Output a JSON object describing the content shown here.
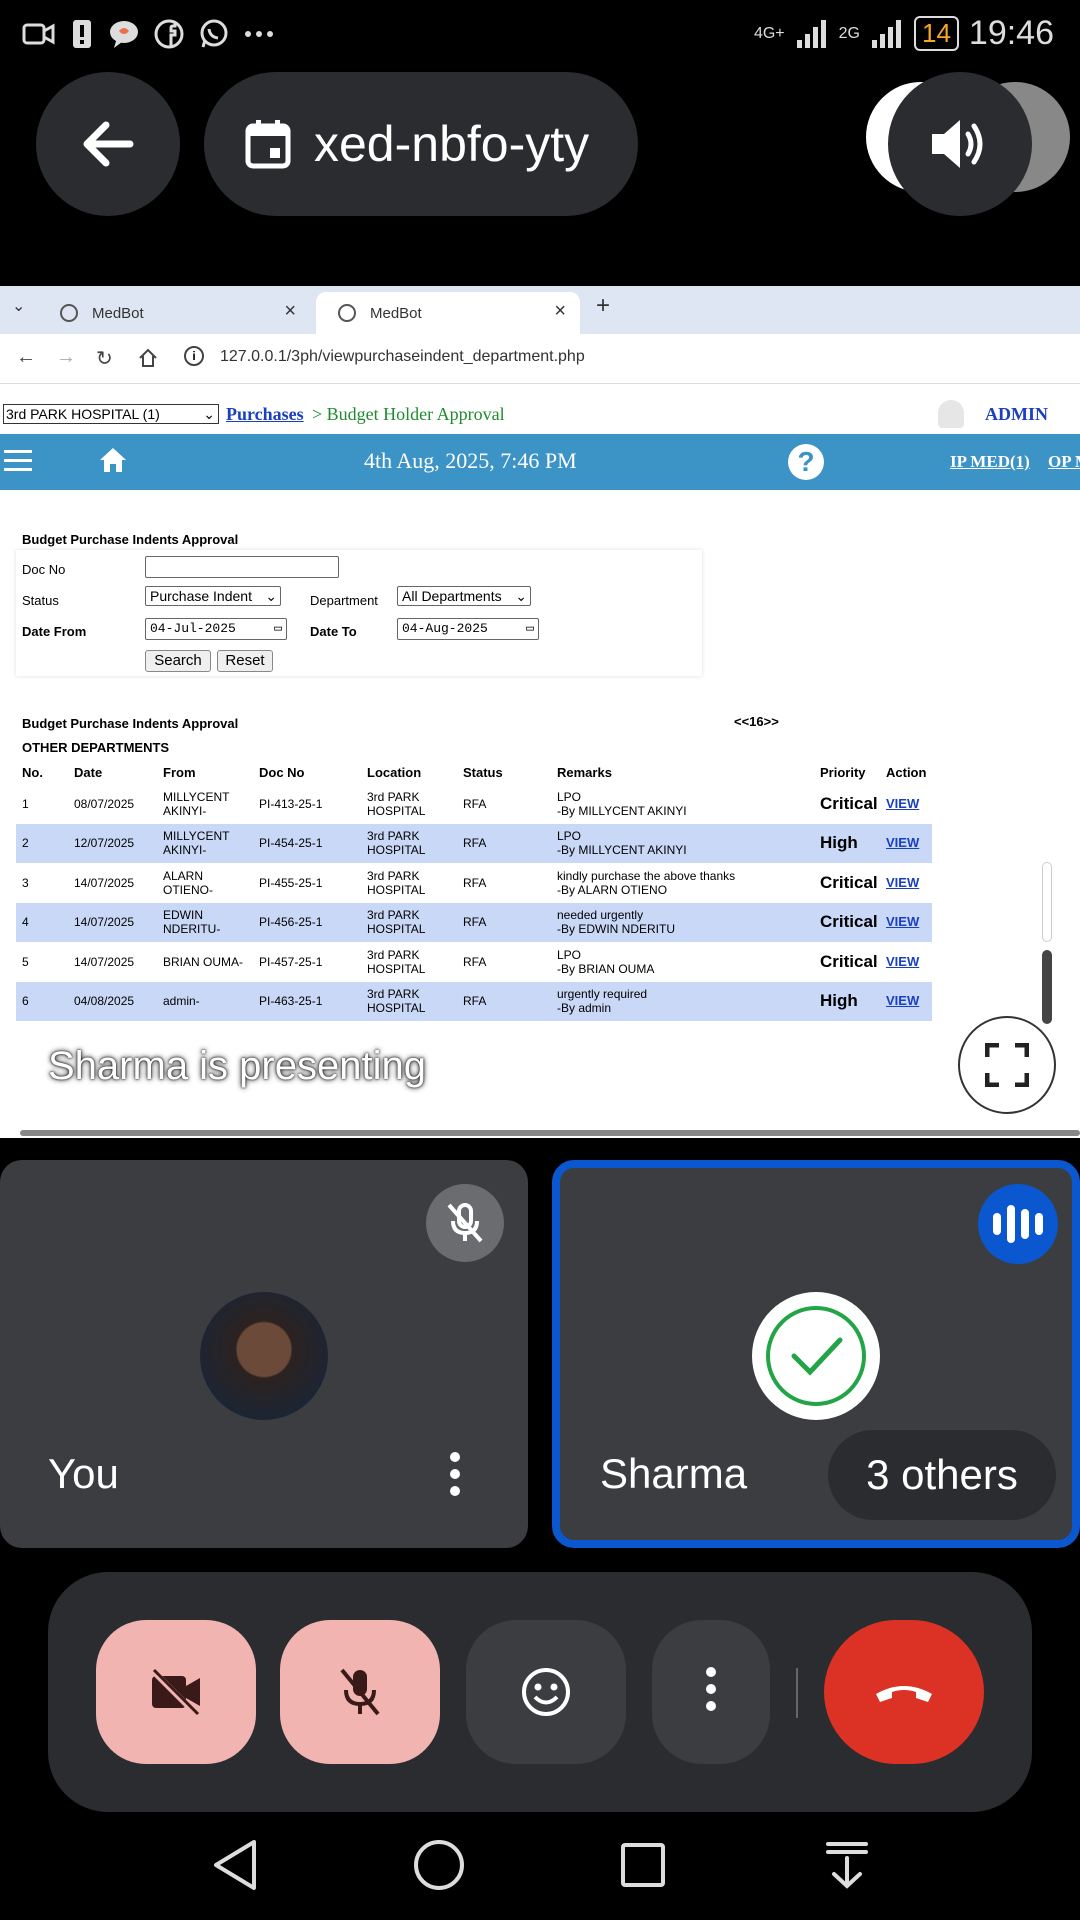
{
  "status_bar": {
    "network_1": "4G+",
    "network_2": "2G",
    "battery": "14",
    "time": "19:46"
  },
  "call": {
    "meeting_code": "xed-nbfo-yty"
  },
  "browser": {
    "tabs": [
      {
        "label": "MedBot"
      },
      {
        "label": "MedBot"
      }
    ],
    "url": "127.0.0.1/3ph/viewpurchaseindent_department.php"
  },
  "app": {
    "hospital_select": "3rd PARK HOSPITAL (1)",
    "breadcrumb_link": "Purchases",
    "breadcrumb_current": "> Budget Holder Approval",
    "user": "ADMIN",
    "datetime": "4th Aug, 2025, 7:46 PM",
    "help": "?",
    "ip_med": "IP MED(1)",
    "op_med": "OP MED"
  },
  "filters": {
    "title": "Budget Purchase Indents Approval",
    "doc_no_label": "Doc No",
    "doc_no_value": "",
    "status_label": "Status",
    "status_value": "Purchase Indent",
    "department_label": "Department",
    "department_value": "All Departments",
    "date_from_label": "Date From",
    "date_from_value": "04-Jul-2025",
    "date_to_label": "Date To",
    "date_to_value": "04-Aug-2025",
    "search_label": "Search",
    "reset_label": "Reset"
  },
  "list": {
    "title": "Budget Purchase Indents Approval",
    "subtitle": "OTHER DEPARTMENTS",
    "pager": "<<16>>",
    "columns": [
      "No.",
      "Date",
      "From",
      "Doc No",
      "Location",
      "Status",
      "Remarks",
      "Priority",
      "Action"
    ],
    "rows": [
      {
        "no": "1",
        "date": "08/07/2025",
        "from": "MILLYCENT AKINYI-",
        "doc": "PI-413-25-1",
        "location": "3rd PARK HOSPITAL",
        "status": "RFA",
        "remark": "LPO",
        "by": "-By MILLYCENT AKINYI",
        "priority": "Critical",
        "action": "VIEW"
      },
      {
        "no": "2",
        "date": "12/07/2025",
        "from": "MILLYCENT AKINYI-",
        "doc": "PI-454-25-1",
        "location": "3rd PARK HOSPITAL",
        "status": "RFA",
        "remark": "LPO",
        "by": "-By MILLYCENT AKINYI",
        "priority": "High",
        "action": "VIEW"
      },
      {
        "no": "3",
        "date": "14/07/2025",
        "from": "ALARN OTIENO-",
        "doc": "PI-455-25-1",
        "location": "3rd PARK HOSPITAL",
        "status": "RFA",
        "remark": "kindly purchase the above thanks",
        "by": "-By ALARN OTIENO",
        "priority": "Critical",
        "action": "VIEW"
      },
      {
        "no": "4",
        "date": "14/07/2025",
        "from": "EDWIN NDERITU-",
        "doc": "PI-456-25-1",
        "location": "3rd PARK HOSPITAL",
        "status": "RFA",
        "remark": "needed urgently",
        "by": "-By EDWIN NDERITU",
        "priority": "Critical",
        "action": "VIEW"
      },
      {
        "no": "5",
        "date": "14/07/2025",
        "from": "BRIAN OUMA-",
        "doc": "PI-457-25-1",
        "location": "3rd PARK HOSPITAL",
        "status": "RFA",
        "remark": "LPO",
        "by": "-By BRIAN OUMA",
        "priority": "Critical",
        "action": "VIEW"
      },
      {
        "no": "6",
        "date": "04/08/2025",
        "from": "admin-",
        "doc": "PI-463-25-1",
        "location": "3rd PARK HOSPITAL",
        "status": "RFA",
        "remark": "urgently required",
        "by": "-By admin",
        "priority": "High",
        "action": "VIEW"
      }
    ]
  },
  "presenting_text": "Sharma is presenting",
  "tiles": {
    "you": {
      "name": "You"
    },
    "sharma": {
      "name": "Sharma",
      "others": "3 others"
    }
  },
  "colors": {
    "accent": "#0b57d0",
    "end_call": "#dc3226",
    "muted": "#f1b4b0",
    "app_bar": "#3b93c6"
  },
  "icons": [
    "back-arrow-icon",
    "calendar-icon",
    "speaker-icon",
    "mic-off-icon",
    "camera-off-icon",
    "emoji-icon",
    "more-vert-icon",
    "end-call-icon",
    "fullscreen-icon",
    "check-icon",
    "audio-wave-icon"
  ]
}
